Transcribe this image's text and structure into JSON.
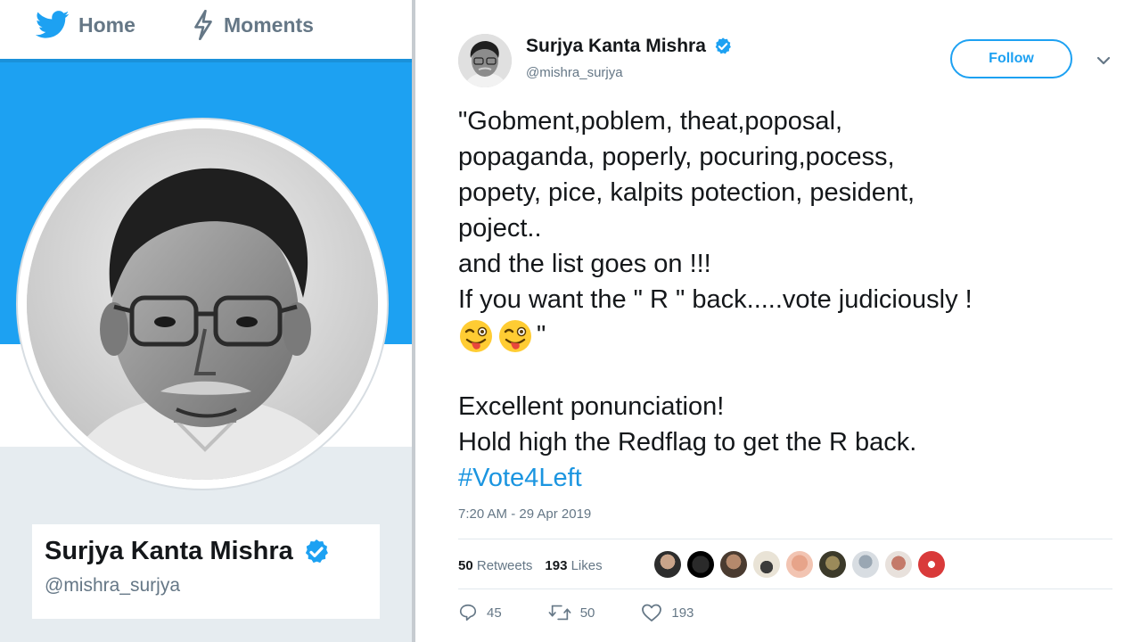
{
  "topnav": {
    "home_label": "Home",
    "moments_label": "Moments"
  },
  "profile": {
    "name": "Surjya Kanta Mishra",
    "handle": "@mishra_surjya"
  },
  "tweet": {
    "author_name": "Surjya Kanta Mishra",
    "author_handle": "@mishra_surjya",
    "follow_label": "Follow",
    "lines": [
      "\"Gobment,poblem, theat,poposal,",
      "popaganda, poperly, pocuring,pocess,",
      "popety, pice, kalpits  potection, pesident,",
      "poject..",
      "and the list goes on !!!",
      "If you want the \" R \" back.....vote judiciously !"
    ],
    "emoji_tail": "\"",
    "lines_after": [
      "Excellent ponunciation!",
      "Hold high the Redflag to get the R back."
    ],
    "hashtag": "#Vote4Left",
    "timestamp": "7:20 AM - 29 Apr 2019",
    "retweets_count": "50",
    "retweets_label": "Retweets",
    "likes_count": "193",
    "likes_label": "Likes",
    "reply_count": "45",
    "retweet_action_count": "50",
    "like_action_count": "193"
  },
  "colors": {
    "twitter_blue": "#1da1f2",
    "hashtag_blue": "#1b95e0",
    "muted_gray": "#657786",
    "verified_blue": "#1da1f2"
  },
  "icons": {
    "logo": "twitter-bird-icon",
    "moments": "lightning-icon",
    "verified": "verified-badge-icon",
    "caret": "chevron-down-icon",
    "reply": "reply-icon",
    "retweet": "retweet-icon",
    "like": "heart-icon",
    "emoji": "winking-face-with-tongue-emoji"
  }
}
